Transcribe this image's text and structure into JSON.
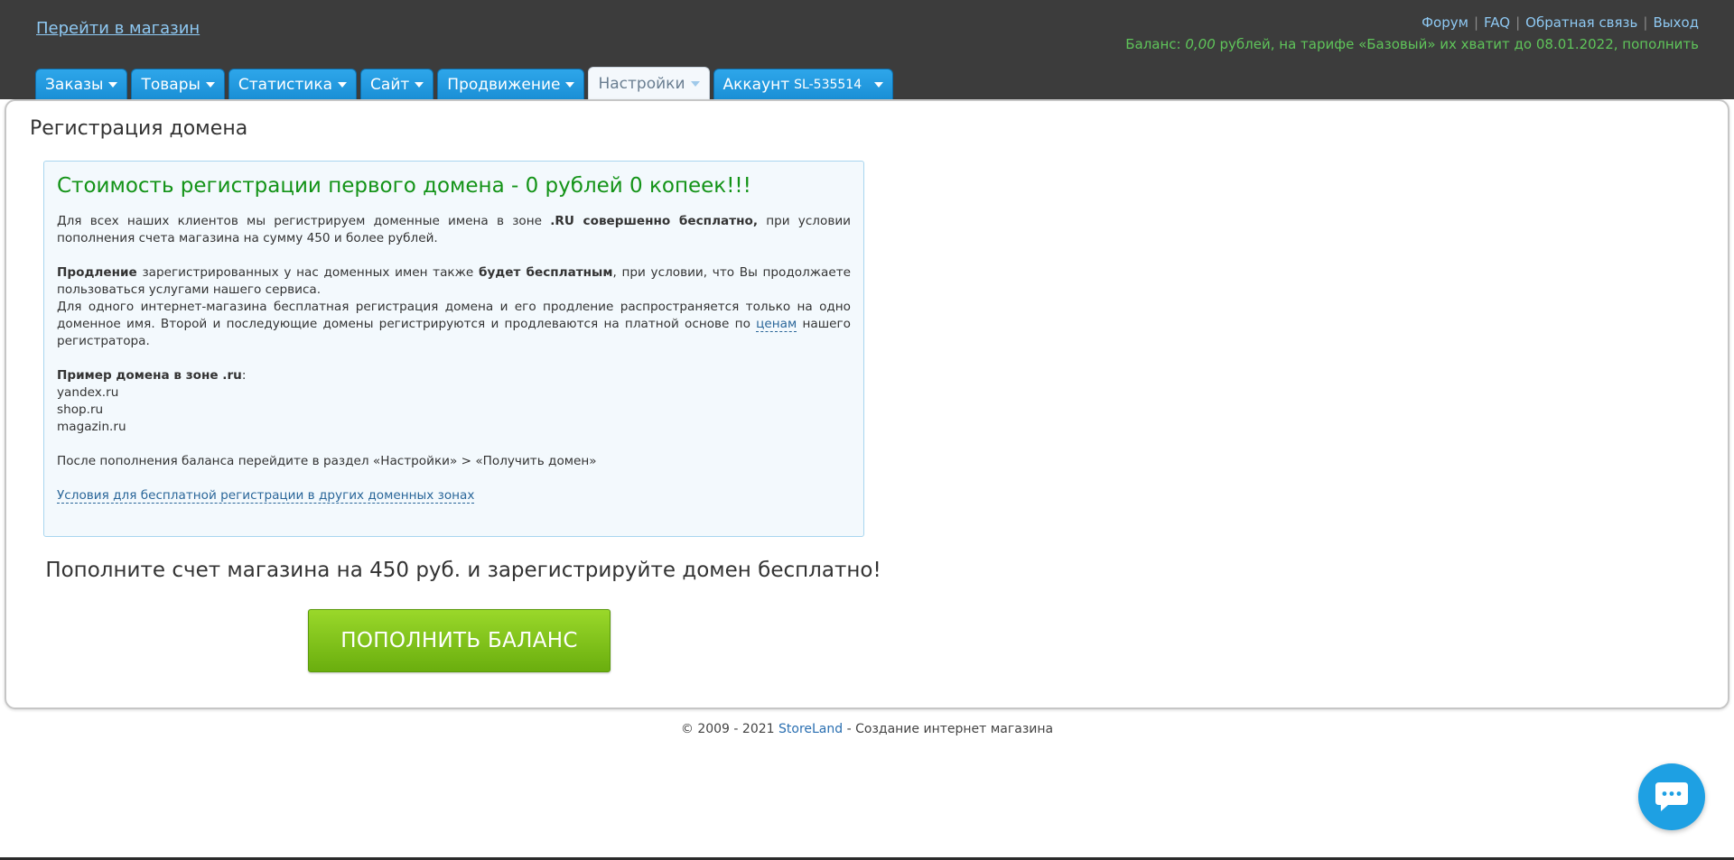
{
  "header": {
    "store_link": "Перейти в магазин",
    "links": [
      {
        "label": "Форум"
      },
      {
        "label": "FAQ"
      },
      {
        "label": "Обратная связь"
      },
      {
        "label": "Выход"
      }
    ],
    "balance": {
      "prefix": "Баланс: ",
      "value": "0,00",
      "middle": " рублей, на тарифе «Базовый» их хватит до 08.01.2022, ",
      "topup": "пополнить"
    }
  },
  "tabs": [
    {
      "label": "Заказы"
    },
    {
      "label": "Товары"
    },
    {
      "label": "Статистика"
    },
    {
      "label": "Сайт"
    },
    {
      "label": "Продвижение"
    },
    {
      "label": "Настройки"
    },
    {
      "label": "Аккаунт",
      "id": "SL-535514"
    }
  ],
  "main": {
    "title": "Регистрация домена",
    "info": {
      "heading": "Стоимость регистрации первого домена - 0 рублей 0 копеек!!!",
      "p1_a": "Для всех наших клиентов мы регистрируем доменные имена в зоне ",
      "p1_b": ".RU совершенно бесплатно,",
      "p1_c": " при условии пополнения счета магазина на сумму 450 и более рублей.",
      "p2_a": "Продление",
      "p2_b": " зарегистрированных у нас доменных имен также ",
      "p2_c": "будет бесплатным",
      "p2_d": ", при условии, что Вы продолжаете пользоваться услугами нашего сервиса.",
      "p3_a": "Для одного интернет-магазина бесплатная регистрация домена и его продление распространяется только на одно доменное имя. Второй и последующие домены регистрируются и продлеваются на платной основе по ",
      "p3_link": "ценам",
      "p3_b": " нашего регистратора.",
      "example_title": "Пример домена в зоне .ru",
      "example_colon": ":",
      "examples": [
        "yandex.ru",
        "shop.ru",
        "magazin.ru"
      ],
      "after_topup": "После пополнения баланса перейдите в раздел «Настройки» > «Получить домен»",
      "conditions_link": "Условия для бесплатной регистрации в других доменных зонах"
    },
    "promo": "Пополните счет магазина на 450 руб. и зарегистрируйте домен бесплатно!",
    "topup_button": "ПОПОЛНИТЬ БАЛАНС"
  },
  "footer": {
    "copyright": "© 2009 - 2021 ",
    "brand": "StoreLand",
    "tail": " - Создание интернет магазина"
  },
  "colors": {
    "header_bg": "#3c3c3c",
    "tab_blue": "#1a8fd6",
    "heading_green": "#139317",
    "balance_green": "#5fc45a",
    "button_green": "#7dc11a",
    "chat_blue": "#1ea0e3"
  },
  "icons": {
    "caret": "chevron-down-icon",
    "chat": "chat-bubble-icon"
  }
}
